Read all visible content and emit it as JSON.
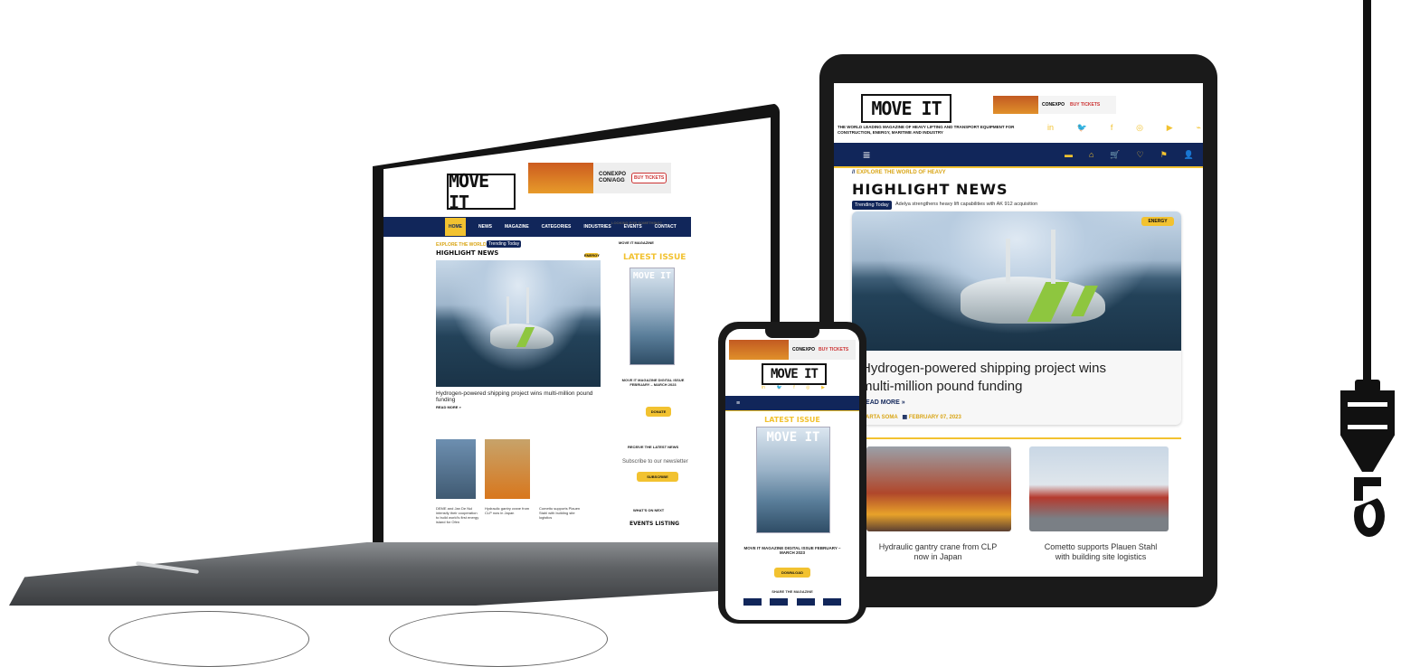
{
  "brand": {
    "logo": "MOVE IT",
    "accent": "#f2c230",
    "navy": "#11265a"
  },
  "ad": {
    "line1": "CONEXPO",
    "line2": "CON/AGG",
    "promo": "Use code",
    "promo2": "to save 20%",
    "dates": "March 14-18, 2023",
    "place": "Las Vegas, NV",
    "cta": "BUY TICKETS"
  },
  "tablet": {
    "tagline": "THE WORLD LEADING MAGAZINE OF HEAVY LIFTING AND TRANSPORT EQUIPMENT FOR CONSTRUCTION, ENERGY, MARITIME AND INDUSTRY",
    "social_icons": [
      "in",
      "🐦",
      "f",
      "◎",
      "▶",
      "⌁"
    ],
    "nav_icons": [
      "▬",
      "⌂",
      "🛒",
      "♡",
      "⚑",
      "👤"
    ],
    "menu_icon": "≡",
    "kicker": "EXPLORE THE WORLD OF HEAVY",
    "section_title": "HIGHLIGHT NEWS",
    "trending_label": "Trending Today",
    "trending_text": "Adelya strengthens heavy lift capabilities with AK 912 acquisition",
    "badge": "ENERGY",
    "headline_line1": "Hydrogen-powered shipping project wins",
    "headline_line2": "multi-million pound funding",
    "read_more": "READ MORE »",
    "author": "MARTA SOMA",
    "date": "FEBRUARY 07, 2023",
    "cards": [
      {
        "title_line1": "Hydraulic gantry crane from CLP",
        "title_line2": "now in Japan"
      },
      {
        "title_line1": "Cometto supports Plauen Stahl",
        "title_line2": "with building site logistics"
      }
    ]
  },
  "laptop": {
    "nav": [
      "HOME",
      "NEWS",
      "MAGAZINE",
      "CATEGORIES",
      "INDUSTRIES",
      "EVENTS",
      "CONTACT"
    ],
    "kicker": "EXPLORE THE WORLD OF HEAVY",
    "trending_label": "Trending Today",
    "section_title": "HIGHLIGHT NEWS",
    "badge": "ENERGY",
    "headline": "Hydrogen-powered shipping project wins multi-million pound funding",
    "read_more": "READ MORE »",
    "search_label": "LOOKING FOR SOMETHING?",
    "sidebar_kicker": "MOVE IT MAGAZINE",
    "latest_issue": "LATEST ISSUE",
    "issue_caption": "MOVE IT MAGAZINE DIGITAL ISSUE FEBRUARY – MARCH 2023",
    "donate": "DONATE",
    "newsletter_kicker": "RECEIVE THE LATEST NEWS",
    "newsletter_text": "Subscribe to our newsletter",
    "subscribe": "SUBSCRIBE",
    "events_kicker": "WHAT'S ON NEXT",
    "events_title": "EVENTS LISTING",
    "cards": [
      "DEME and Jan De Nul intensify their cooperation to build world's first energy island for Ofen",
      "Hydraulic gantry crane from CLP now in Japan",
      "Cometto supports Plauen Stahl with building site logistics"
    ]
  },
  "phone": {
    "section_title": "LATEST ISSUE",
    "issue_caption": "MOVE IT MAGAZINE DIGITAL ISSUE FEBRUARY – MARCH 2023",
    "button": "DOWNLOAD",
    "share_label": "SHARE THE MAGAZINE"
  }
}
